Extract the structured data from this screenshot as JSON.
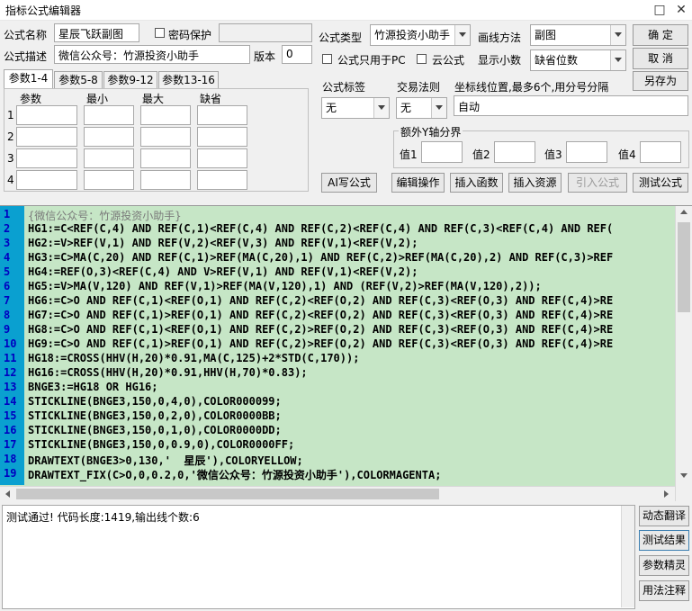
{
  "window": {
    "title": "指标公式编辑器",
    "maximize_glyph": "□",
    "close_glyph": "✕"
  },
  "form": {
    "name_label": "公式名称",
    "name_value": "星辰飞跃副图",
    "password_label": "密码保护",
    "desc_label": "公式描述",
    "desc_value": "微信公众号：竹源投资小助手",
    "version_label": "版本",
    "version_value": "0",
    "type_label": "公式类型",
    "type_value": "竹源投资小助手",
    "draw_method_label": "画线方法",
    "draw_method_value": "副图",
    "pc_only_label": "公式只用于PC",
    "cloud_label": "云公式",
    "decimals_label": "显示小数",
    "decimals_value": "缺省位数",
    "ok_label": "确 定",
    "cancel_label": "取 消",
    "save_as_label": "另存为"
  },
  "tabs": [
    "参数1-4",
    "参数5-8",
    "参数9-12",
    "参数13-16"
  ],
  "params": {
    "headers": [
      "参数",
      "最小",
      "最大",
      "缺省"
    ],
    "rows": [
      "1",
      "2",
      "3",
      "4"
    ]
  },
  "labels_section": {
    "tag_label": "公式标签",
    "tag_value": "无",
    "trade_label": "交易法则",
    "trade_value": "无",
    "coord_label": "坐标线位置,最多6个,用分号分隔",
    "coord_value": "自动",
    "extra_y_label": "额外Y轴分界",
    "val1": "值1",
    "val2": "值2",
    "val3": "值3",
    "val4": "值4"
  },
  "toolbar": {
    "ai_write": "AI写公式",
    "edit_ops": "编辑操作",
    "insert_func": "插入函数",
    "insert_resource": "插入资源",
    "import_formula": "引入公式",
    "test_formula": "测试公式"
  },
  "editor": {
    "lines": [
      "{微信公众号：竹源投资小助手}",
      "HG1:=C<REF(C,4) AND REF(C,1)<REF(C,4) AND REF(C,2)<REF(C,4) AND REF(C,3)<REF(C,4) AND REF(",
      "HG2:=V>REF(V,1) AND REF(V,2)<REF(V,3) AND REF(V,1)<REF(V,2);",
      "HG3:=C>MA(C,20) AND REF(C,1)>REF(MA(C,20),1) AND REF(C,2)>REF(MA(C,20),2) AND REF(C,3)>REF",
      "HG4:=REF(O,3)<REF(C,4) AND V>REF(V,1) AND REF(V,1)<REF(V,2);",
      "HG5:=V>MA(V,120) AND REF(V,1)>REF(MA(V,120),1) AND (REF(V,2)>REF(MA(V,120),2));",
      "HG6:=C>O AND REF(C,1)<REF(O,1) AND REF(C,2)<REF(O,2) AND REF(C,3)<REF(O,3) AND REF(C,4)>RE",
      "HG7:=C>O AND REF(C,1)>REF(O,1) AND REF(C,2)<REF(O,2) AND REF(C,3)<REF(O,3) AND REF(C,4)>RE",
      "HG8:=C>O AND REF(C,1)<REF(O,1) AND REF(C,2)>REF(O,2) AND REF(C,3)<REF(O,3) AND REF(C,4)>RE",
      "HG9:=C>O AND REF(C,1)>REF(O,1) AND REF(C,2)>REF(O,2) AND REF(C,3)<REF(O,3) AND REF(C,4)>RE",
      "HG18:=CROSS(HHV(H,20)*0.91,MA(C,125)+2*STD(C,170));",
      "HG16:=CROSS(HHV(H,20)*0.91,HHV(H,70)*0.83);",
      "BNGE3:=HG18 OR HG16;",
      "STICKLINE(BNGE3,150,0,4,0),COLOR000099;",
      "STICKLINE(BNGE3,150,0,2,0),COLOR0000BB;",
      "STICKLINE(BNGE3,150,0,1,0),COLOR0000DD;",
      "STICKLINE(BNGE3,150,0,0.9,0),COLOR0000FF;",
      "DRAWTEXT(BNGE3>0,130,'  星辰'),COLORYELLOW;",
      "DRAWTEXT_FIX(C>O,0,0.2,0,'微信公众号：竹源投资小助手'),COLORMAGENTA;"
    ]
  },
  "result": {
    "text": "测试通过! 代码长度:1419,输出线个数:6"
  },
  "side_buttons": {
    "dynamic_translate": "动态翻译",
    "test_result": "测试结果",
    "param_wizard": "参数精灵",
    "usage_notes": "用法注释"
  }
}
